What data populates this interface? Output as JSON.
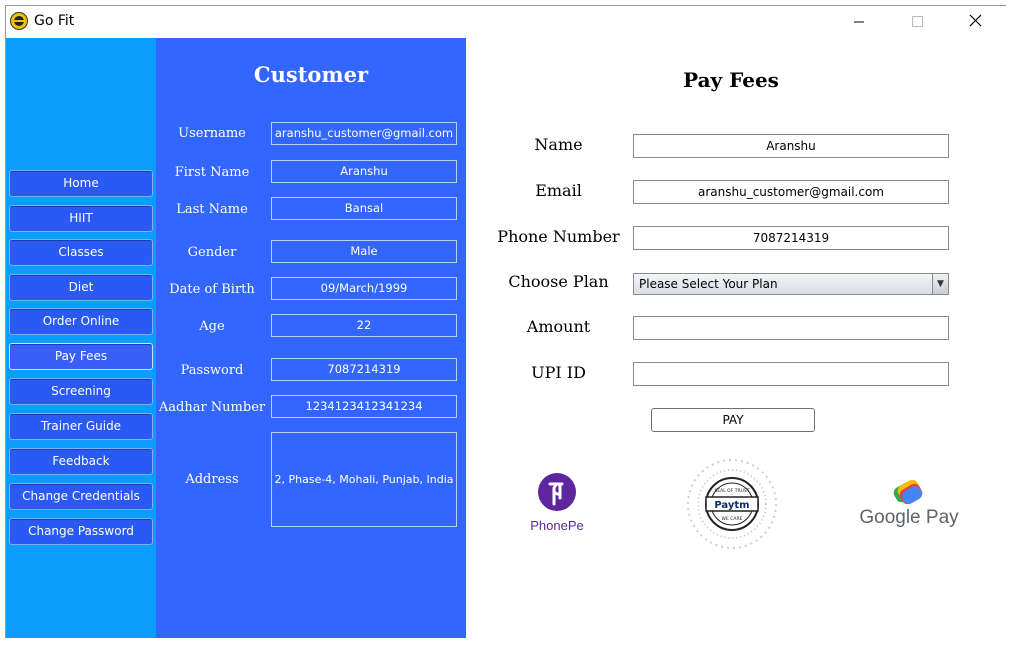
{
  "window": {
    "title": "Go Fit"
  },
  "sidebar": {
    "items": [
      {
        "label": "Home"
      },
      {
        "label": "HIIT"
      },
      {
        "label": "Classes"
      },
      {
        "label": "Diet"
      },
      {
        "label": "Order Online"
      },
      {
        "label": "Pay Fees"
      },
      {
        "label": "Screening"
      },
      {
        "label": "Trainer  Guide"
      },
      {
        "label": "Feedback"
      },
      {
        "label": "Change Credentials"
      },
      {
        "label": "Change Password"
      }
    ]
  },
  "customer": {
    "title": "Customer",
    "username_label": "Username",
    "username": "aranshu_customer@gmail.com",
    "first_name_label": "First Name",
    "first_name": "Aranshu",
    "last_name_label": "Last Name",
    "last_name": "Bansal",
    "gender_label": "Gender",
    "gender": "Male",
    "dob_label": "Date of Birth",
    "dob": "09/March/1999",
    "age_label": "Age",
    "age": "22",
    "password_label": "Password",
    "password": "7087214319",
    "aadhar_label": "Aadhar Number",
    "aadhar": "1234123412341234",
    "address_label": "Address",
    "address": "2, Phase-4, Mohali, Punjab, India"
  },
  "pay": {
    "title": "Pay Fees",
    "name_label": "Name",
    "name": "Aranshu",
    "email_label": "Email",
    "email": "aranshu_customer@gmail.com",
    "phone_label": "Phone Number",
    "phone": "7087214319",
    "plan_label": "Choose Plan",
    "plan_selected": "Please Select Your Plan",
    "amount_label": "Amount",
    "amount": "",
    "upi_label": "UPI ID",
    "upi": "",
    "pay_button": "PAY",
    "phonepe_label": "PhonePe",
    "paytm_text": "Paytm",
    "gpay_label": "Google Pay"
  },
  "colors": {
    "sidebar_bg": "#0A9DFB",
    "customer_bg": "#3366FF",
    "nav_button_bg": "#2B59F4",
    "phonepe_purple": "#5F259F"
  }
}
